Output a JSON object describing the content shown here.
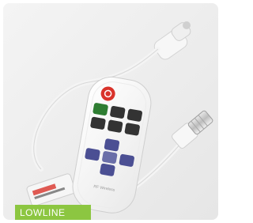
{
  "brand": {
    "label": "LOWLINE",
    "color": "#8cc641"
  },
  "photo": {
    "remote": {
      "power_button_color": "#d9332b",
      "button_color": "#333333",
      "accent_button_color": "#2e7d32",
      "dpad_color": "#4b4f93",
      "label_text": "RF Wireless"
    }
  }
}
